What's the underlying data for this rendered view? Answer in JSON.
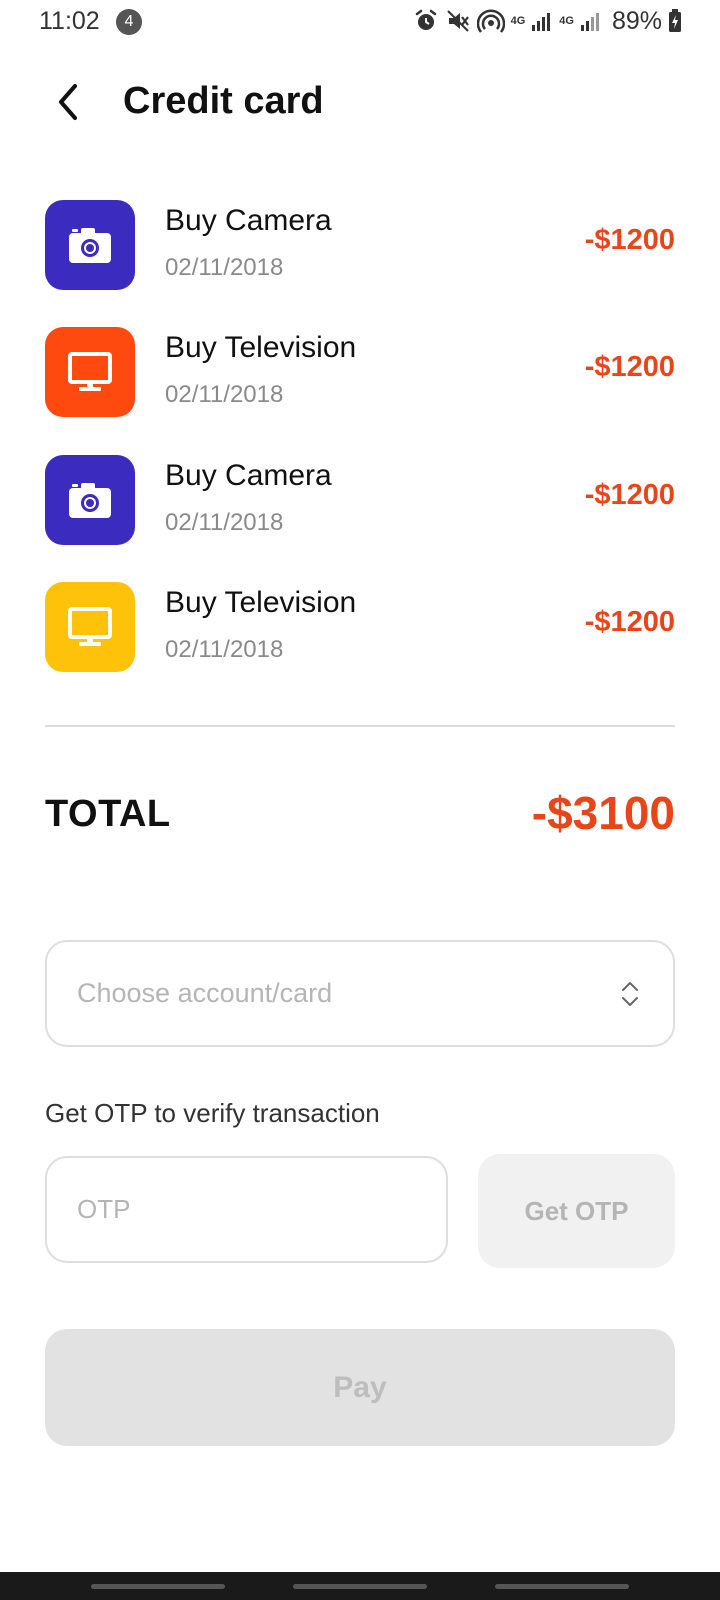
{
  "status_bar": {
    "time": "11:02",
    "notification_count": "4",
    "network_1": "4G",
    "network_2": "4G",
    "battery": "89%"
  },
  "header": {
    "title": "Credit card"
  },
  "transactions": [
    {
      "title": "Buy Camera",
      "date": "02/11/2018",
      "amount": "-$1200",
      "icon": "camera-icon",
      "color": "#3c2bbf"
    },
    {
      "title": "Buy Television",
      "date": "02/11/2018",
      "amount": "-$1200",
      "icon": "monitor-icon",
      "color": "#ff4a0f"
    },
    {
      "title": "Buy Camera",
      "date": "02/11/2018",
      "amount": "-$1200",
      "icon": "camera-icon",
      "color": "#3c2bbf"
    },
    {
      "title": "Buy Television",
      "date": "02/11/2018",
      "amount": "-$1200",
      "icon": "monitor-icon",
      "color": "#ffc20a"
    }
  ],
  "total": {
    "label": "TOTAL",
    "value": "-$3100"
  },
  "account_select": {
    "placeholder": "Choose account/card"
  },
  "otp": {
    "hint": "Get OTP to verify transaction",
    "placeholder": "OTP",
    "button_label": "Get OTP"
  },
  "pay": {
    "label": "Pay"
  },
  "colors": {
    "accent": "#e8461a",
    "disabled_bg": "#e2e2e2"
  }
}
